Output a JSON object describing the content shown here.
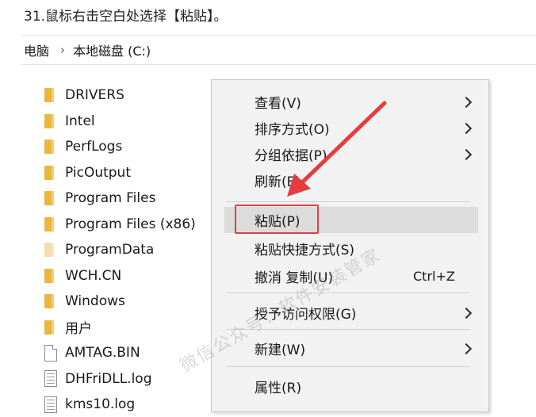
{
  "caption": "31.鼠标右击空白处选择【粘贴】。",
  "address_bar": {
    "crumbs": [
      "电脑",
      "本地磁盘 (C:)"
    ]
  },
  "files": [
    {
      "name": "DRIVERS",
      "icon": "folder-icon"
    },
    {
      "name": "Intel",
      "icon": "folder-icon"
    },
    {
      "name": "PerfLogs",
      "icon": "folder-icon"
    },
    {
      "name": "PicOutput",
      "icon": "folder-icon"
    },
    {
      "name": "Program Files",
      "icon": "folder-icon"
    },
    {
      "name": "Program Files (x86)",
      "icon": "folder-icon"
    },
    {
      "name": "ProgramData",
      "icon": "folder-faded-icon"
    },
    {
      "name": "WCH.CN",
      "icon": "folder-icon"
    },
    {
      "name": "Windows",
      "icon": "folder-icon"
    },
    {
      "name": "用户",
      "icon": "folder-icon"
    },
    {
      "name": "AMTAG.BIN",
      "icon": "file-icon"
    },
    {
      "name": "DHFriDLL.log",
      "icon": "text-file-icon"
    },
    {
      "name": "kms10.log",
      "icon": "text-file-icon"
    }
  ],
  "context_menu": {
    "items": [
      {
        "label": "查看(V)",
        "submenu": true
      },
      {
        "label": "排序方式(O)",
        "submenu": true
      },
      {
        "label": "分组依据(P)",
        "submenu": true
      },
      {
        "label": "刷新(E)",
        "submenu": false
      },
      {
        "label": "粘贴(P)",
        "submenu": false,
        "highlighted": true
      },
      {
        "label": "粘贴快捷方式(S)",
        "submenu": false
      },
      {
        "label": "撤消 复制(U)",
        "shortcut": "Ctrl+Z",
        "submenu": false
      },
      {
        "label": "授予访问权限(G)",
        "submenu": true
      },
      {
        "label": "新建(W)",
        "submenu": true
      },
      {
        "label": "属性(R)",
        "submenu": false
      }
    ]
  },
  "watermark": "微信公众号：软件安装管家",
  "colors": {
    "highlight_box": "#e43d3d",
    "annotation_arrow": "#e43d3d",
    "menu_background": "#f2f2f2",
    "menu_hover": "#dcdcdc",
    "folder": "#e8b73d"
  }
}
